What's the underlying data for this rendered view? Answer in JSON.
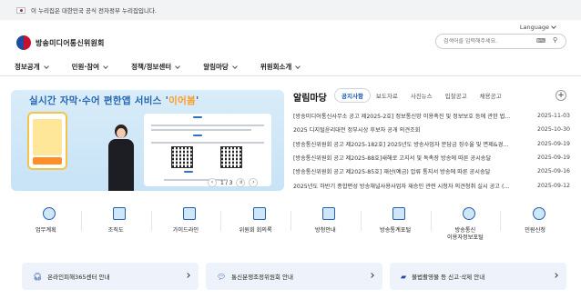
{
  "gov_banner": {
    "text": "이 누리집은 대한민국 공식 전자정부 누리집입니다."
  },
  "header": {
    "language_label": "Language",
    "logo_text": "방송미디어통신위원회",
    "search_placeholder": "검색어를 입력해주세요."
  },
  "gnb": {
    "items": [
      {
        "label": "정보공개"
      },
      {
        "label": "민원·참여"
      },
      {
        "label": "정책/정보센터"
      },
      {
        "label": "알림마당"
      },
      {
        "label": "위원회소개"
      }
    ]
  },
  "banner": {
    "headline_prefix": "실시간 자막·수어 편한앱 서비스 '",
    "headline_brand": "이어봄",
    "headline_suffix": "'",
    "page_indicator": "1 / 3"
  },
  "notice": {
    "title": "알림마당",
    "tabs": [
      {
        "label": "공지사항",
        "active": true
      },
      {
        "label": "보도자료",
        "active": false
      },
      {
        "label": "사진뉴스",
        "active": false
      },
      {
        "label": "입찰공고",
        "active": false
      },
      {
        "label": "채용공고",
        "active": false
      }
    ],
    "more_label": "+",
    "items": [
      {
        "title": "[방송미디어통신사무소 공고 제2025-2호] 정보통신망 이용촉진 및 정보보호 등에 관한 법...",
        "date": "2025-11-03"
      },
      {
        "title": "2025 디지털윤리대전 정부시상 후보자 공개 의견조회",
        "date": "2025-10-30"
      },
      {
        "title": "[방송통신위원회 공고 제2025-182호] 2025년도 방송사업자 분담금 징수율 및 면제&경...",
        "date": "2025-09-19"
      },
      {
        "title": "[방송통신위원회 공고 제2025-88호]새해로 고지서 및 독촉장 방송에 따른 공시송달",
        "date": "2025-09-19"
      },
      {
        "title": "[방송통신위원회 공고 제2025-85호] 재산(예금) 압류 통지서 방송에 따른 공시송달",
        "date": "2025-09-16"
      },
      {
        "title": "2025년도 하반기 종합편성 방송채널사용사업자 재승인 관련 시청자 의견청취 실시 공고 (...",
        "date": "2025-09-12"
      }
    ]
  },
  "quick_menu": [
    {
      "label": "업무계획",
      "icon": "target-icon"
    },
    {
      "label": "조직도",
      "icon": "org-chart-icon"
    },
    {
      "label": "가이드라인",
      "icon": "guideline-doc-icon"
    },
    {
      "label": "위원회 회의록",
      "icon": "minutes-doc-icon"
    },
    {
      "label": "방청안내",
      "icon": "hands-icon"
    },
    {
      "label": "방송통계포털",
      "icon": "stats-chart-icon"
    },
    {
      "label": "방송통신\n이용자정보포털",
      "icon": "user-portal-icon"
    },
    {
      "label": "민원신청",
      "icon": "complaint-icon"
    }
  ],
  "bottom_links": [
    {
      "label": "온라인피해365센터 안내",
      "icon": "headset-icon"
    },
    {
      "label": "통신분쟁조정위원회 안내",
      "icon": "chat-icon"
    },
    {
      "label": "불법촬영물 등 신고·삭제 안내",
      "icon": "alert-icon"
    }
  ],
  "colors": {
    "accent": "#1a55b3",
    "brand_red": "#c8102e",
    "brand_blue": "#1e4ba0",
    "banner_bg": "#d9ecf9"
  }
}
